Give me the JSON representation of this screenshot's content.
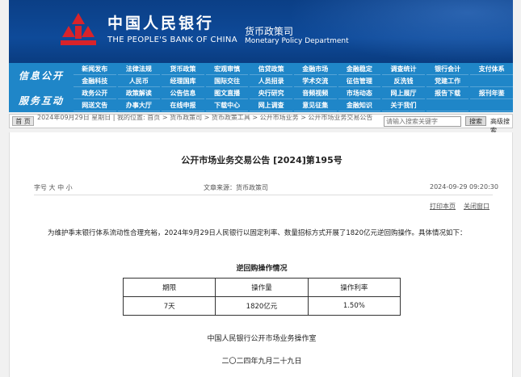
{
  "header": {
    "cn_name": "中国人民银行",
    "en_name": "THE PEOPLE'S BANK OF CHINA",
    "dept_cn": "货币政策司",
    "dept_en": "Monetary Policy Department",
    "logo_icon": "pboc-logo-icon",
    "brand_color": "#0b3f86",
    "logo_color": "#d8232a"
  },
  "nav": {
    "section_a": "信息公开",
    "section_b": "服务互动",
    "rows": [
      [
        "新闻发布",
        "法律法规",
        "货币政策",
        "宏观审慎",
        "信贷政策",
        "金融市场",
        "金融稳定",
        "调查统计",
        "银行会计",
        "支付体系"
      ],
      [
        "金融科技",
        "人民币",
        "经理国库",
        "国际交往",
        "人员招录",
        "学术交流",
        "征信管理",
        "反洗钱",
        "党建工作",
        ""
      ],
      [
        "政务公开",
        "政策解读",
        "公告信息",
        "图文直播",
        "央行研究",
        "音频视频",
        "市场动态",
        "网上展厅",
        "报告下载",
        "报刊年鉴"
      ],
      [
        "网送文告",
        "办事大厅",
        "在线申报",
        "下载中心",
        "网上调查",
        "意见征集",
        "金融知识",
        "关于我们",
        "",
        ""
      ]
    ]
  },
  "crumb": {
    "home": "首 页",
    "path": "2024年09月29日 星期日 | 我的位置: 首页 > 货币政策司 > 货币政策工具 > 公开市场业务 > 公开市场业务交易公告",
    "search_placeholder": "请输入搜索关键字",
    "search_button": "搜索",
    "advanced": "高级搜索"
  },
  "article": {
    "title": "公开市场业务交易公告 [2024]第195号",
    "font_size": "字号 大 中 小",
    "source": "文章来源：货币政策司",
    "datetime": "2024-09-29 09:20:30",
    "print": "打印本页",
    "close": "关闭窗口",
    "body": "为维护季末银行体系流动性合理充裕，2024年9月29日人民银行以固定利率、数量招标方式开展了1820亿元逆回购操作。具体情况如下：",
    "table_title": "逆回购操作情况",
    "table_headers": [
      "期限",
      "操作量",
      "操作利率"
    ],
    "table_row": [
      "7天",
      "1820亿元",
      "1.50%"
    ],
    "signature": "中国人民银行公开市场业务操作室",
    "sign_date": "二〇二四年九月二十九日"
  }
}
